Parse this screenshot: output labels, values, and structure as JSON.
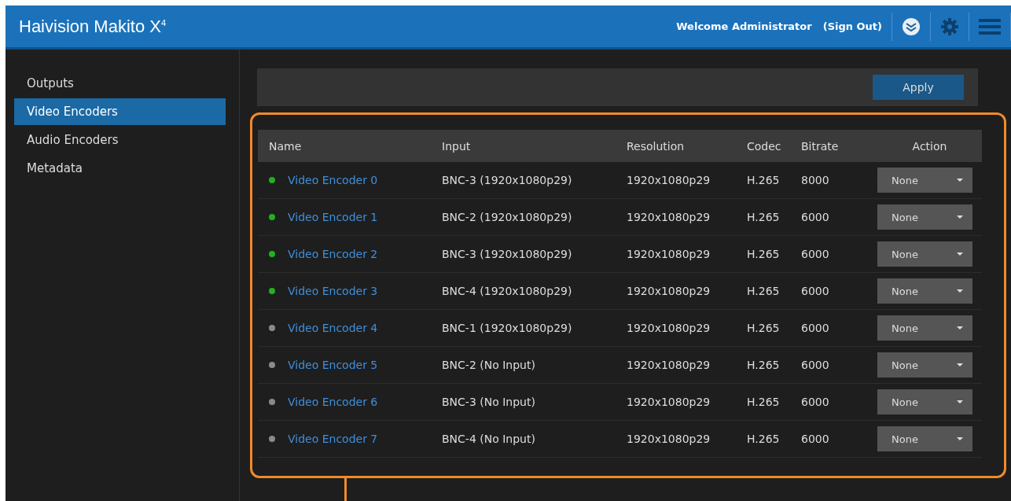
{
  "header": {
    "brand": "Haivision Makito X",
    "brand_sup": "4",
    "welcome": "Welcome Administrator",
    "sign_out": "(Sign Out)"
  },
  "sidebar": {
    "items": [
      {
        "label": "Outputs",
        "selected": false
      },
      {
        "label": "Video Encoders",
        "selected": true
      },
      {
        "label": "Audio Encoders",
        "selected": false
      },
      {
        "label": "Metadata",
        "selected": false
      }
    ]
  },
  "toolbar": {
    "apply": "Apply"
  },
  "table": {
    "columns": [
      "Name",
      "Input",
      "Resolution",
      "Codec",
      "Bitrate",
      "Action"
    ],
    "rows": [
      {
        "color": "#22b022",
        "name": "Video Encoder 0",
        "input": "BNC-3 (1920x1080p29)",
        "resolution": "1920x1080p29",
        "codec": "H.265",
        "bitrate": "8000",
        "action": "None"
      },
      {
        "color": "#22b022",
        "name": "Video Encoder 1",
        "input": "BNC-2 (1920x1080p29)",
        "resolution": "1920x1080p29",
        "codec": "H.265",
        "bitrate": "6000",
        "action": "None"
      },
      {
        "color": "#22b022",
        "name": "Video Encoder 2",
        "input": "BNC-3 (1920x1080p29)",
        "resolution": "1920x1080p29",
        "codec": "H.265",
        "bitrate": "6000",
        "action": "None"
      },
      {
        "color": "#22b022",
        "name": "Video Encoder 3",
        "input": "BNC-4 (1920x1080p29)",
        "resolution": "1920x1080p29",
        "codec": "H.265",
        "bitrate": "6000",
        "action": "None"
      },
      {
        "color": "#8a8a8a",
        "name": "Video Encoder 4",
        "input": "BNC-1 (1920x1080p29)",
        "resolution": "1920x1080p29",
        "codec": "H.265",
        "bitrate": "6000",
        "action": "None"
      },
      {
        "color": "#8a8a8a",
        "name": "Video Encoder 5",
        "input": "BNC-2 (No Input)",
        "resolution": "1920x1080p29",
        "codec": "H.265",
        "bitrate": "6000",
        "action": "None"
      },
      {
        "color": "#8a8a8a",
        "name": "Video Encoder 6",
        "input": "BNC-3 (No Input)",
        "resolution": "1920x1080p29",
        "codec": "H.265",
        "bitrate": "6000",
        "action": "None"
      },
      {
        "color": "#8a8a8a",
        "name": "Video Encoder 7",
        "input": "BNC-4 (No Input)",
        "resolution": "1920x1080p29",
        "codec": "H.265",
        "bitrate": "6000",
        "action": "None"
      }
    ]
  }
}
